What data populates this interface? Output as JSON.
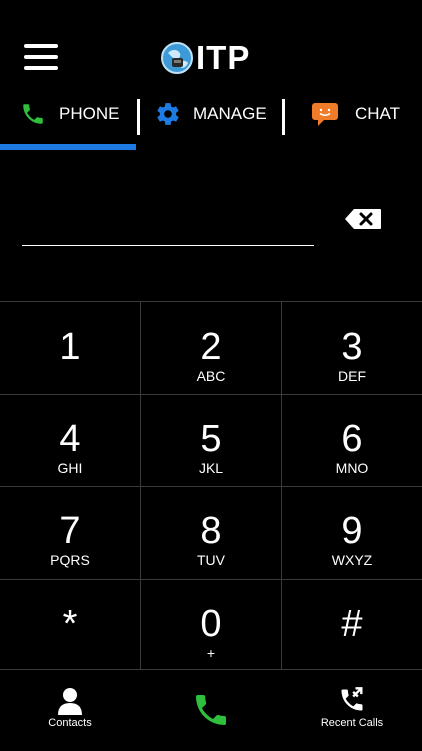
{
  "header": {
    "logo_text": "ITP",
    "menu_icon": "hamburger-menu-icon"
  },
  "tabs": [
    {
      "label": "PHONE",
      "icon": "phone-icon",
      "icon_color": "#2fbf3c",
      "active": true
    },
    {
      "label": "MANAGE",
      "icon": "gear-icon",
      "icon_color": "#1e7be4",
      "active": false
    },
    {
      "label": "CHAT",
      "icon": "chat-bubble-icon",
      "icon_color": "#f07c2a",
      "active": false
    }
  ],
  "colors": {
    "accent": "#1e7be4",
    "call_green": "#2fbf3c",
    "background": "#000000"
  },
  "dialer": {
    "number_value": "",
    "backspace_icon": "backspace-icon"
  },
  "keypad": [
    {
      "digit": "1",
      "letters": ""
    },
    {
      "digit": "2",
      "letters": "ABC"
    },
    {
      "digit": "3",
      "letters": "DEF"
    },
    {
      "digit": "4",
      "letters": "GHI"
    },
    {
      "digit": "5",
      "letters": "JKL"
    },
    {
      "digit": "6",
      "letters": "MNO"
    },
    {
      "digit": "7",
      "letters": "PQRS"
    },
    {
      "digit": "8",
      "letters": "TUV"
    },
    {
      "digit": "9",
      "letters": "WXYZ"
    },
    {
      "digit": "*",
      "letters": ""
    },
    {
      "digit": "0",
      "letters": "+"
    },
    {
      "digit": "#",
      "letters": ""
    }
  ],
  "bottom_bar": {
    "contacts_label": "Contacts",
    "recent_calls_label": "Recent Calls"
  }
}
